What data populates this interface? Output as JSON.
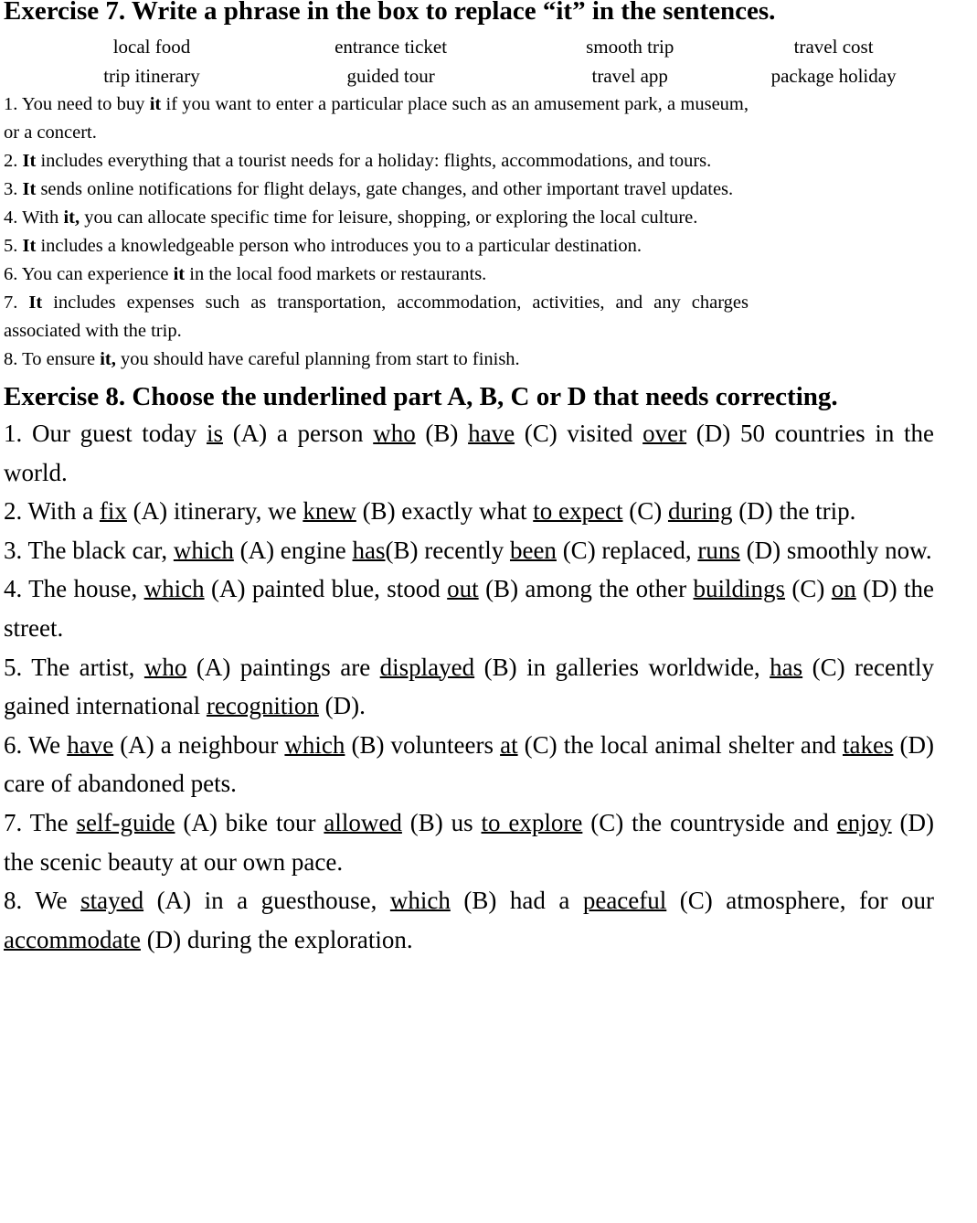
{
  "exercise7": {
    "heading": "Exercise 7. Write a phrase in the box to replace “it” in the sentences.",
    "wordbank": {
      "row1": [
        "local food",
        "entrance ticket",
        "smooth trip",
        "travel cost"
      ],
      "row2": [
        "trip itinerary",
        "guided tour",
        "travel app",
        "package holiday"
      ]
    },
    "items": [
      {
        "number": "1.",
        "parts": [
          {
            "text": " You need to buy ",
            "style": "normal"
          },
          {
            "text": "it",
            "style": "bold"
          },
          {
            "text": " if you want to enter a particular place such as an amusement park, a museum, or a concert.",
            "style": "normal"
          }
        ]
      },
      {
        "number": "2.",
        "parts": [
          {
            "text": " ",
            "style": "normal"
          },
          {
            "text": "It",
            "style": "bold"
          },
          {
            "text": " includes everything that a tourist needs for a holiday: flights, accommodations, and tours.",
            "style": "normal"
          }
        ]
      },
      {
        "number": "3.",
        "parts": [
          {
            "text": " ",
            "style": "normal"
          },
          {
            "text": "It",
            "style": "bold"
          },
          {
            "text": " sends online notifications for flight delays, gate changes, and other important travel updates.",
            "style": "normal"
          }
        ]
      },
      {
        "number": "4.",
        "parts": [
          {
            "text": " With ",
            "style": "normal"
          },
          {
            "text": "it,",
            "style": "bold"
          },
          {
            "text": " you can allocate specific time for leisure, shopping, or exploring the local culture.",
            "style": "normal"
          }
        ]
      },
      {
        "number": "5.",
        "parts": [
          {
            "text": " ",
            "style": "normal"
          },
          {
            "text": "It",
            "style": "bold"
          },
          {
            "text": " includes a knowledgeable person who introduces you to a particular destination.",
            "style": "normal"
          }
        ]
      },
      {
        "number": "6.",
        "parts": [
          {
            "text": " You can experience ",
            "style": "normal"
          },
          {
            "text": "it",
            "style": "bold"
          },
          {
            "text": " in the local food markets or restaurants.",
            "style": "normal"
          }
        ]
      },
      {
        "number": "7.",
        "parts": [
          {
            "text": " ",
            "style": "normal"
          },
          {
            "text": "It",
            "style": "bold"
          },
          {
            "text": " includes expenses such as transportation, accommodation, activities, and any charges associated with the trip.",
            "style": "normal"
          }
        ]
      },
      {
        "number": "8.",
        "parts": [
          {
            "text": " To ensure ",
            "style": "normal"
          },
          {
            "text": "it,",
            "style": "bold"
          },
          {
            "text": " you should have careful planning from start to finish.",
            "style": "normal"
          }
        ]
      }
    ]
  },
  "exercise8": {
    "heading": "Exercise 8. Choose the underlined part A, B, C or D that needs correcting.",
    "items": [
      {
        "number": "1.",
        "parts": [
          {
            "text": " Our guest today ",
            "style": "normal"
          },
          {
            "text": "is",
            "style": "underline"
          },
          {
            "text": " (A) a person ",
            "style": "normal"
          },
          {
            "text": "who",
            "style": "underline"
          },
          {
            "text": " (B) ",
            "style": "normal"
          },
          {
            "text": "have",
            "style": "underline"
          },
          {
            "text": " (C) visited ",
            "style": "normal"
          },
          {
            "text": "over",
            "style": "underline"
          },
          {
            "text": " (D) 50 countries in the world.",
            "style": "normal"
          }
        ]
      },
      {
        "number": "2.",
        "parts": [
          {
            "text": " With a ",
            "style": "normal"
          },
          {
            "text": "fix",
            "style": "underline"
          },
          {
            "text": " (A) itinerary, we ",
            "style": "normal"
          },
          {
            "text": "knew",
            "style": "underline"
          },
          {
            "text": " (B) exactly what ",
            "style": "normal"
          },
          {
            "text": "to expect",
            "style": "underline"
          },
          {
            "text": " (C) ",
            "style": "normal"
          },
          {
            "text": "during",
            "style": "underline"
          },
          {
            "text": " (D) the trip.",
            "style": "normal"
          }
        ]
      },
      {
        "number": "3.",
        "parts": [
          {
            "text": " The black car, ",
            "style": "normal"
          },
          {
            "text": "which",
            "style": "underline"
          },
          {
            "text": " (A) engine ",
            "style": "normal"
          },
          {
            "text": "has",
            "style": "underline"
          },
          {
            "text": "(B) recently ",
            "style": "normal"
          },
          {
            "text": "been",
            "style": "underline"
          },
          {
            "text": " (C) replaced, ",
            "style": "normal"
          },
          {
            "text": "runs",
            "style": "underline"
          },
          {
            "text": " (D) smoothly now.",
            "style": "normal"
          }
        ]
      },
      {
        "number": "4.",
        "parts": [
          {
            "text": " The house, ",
            "style": "normal"
          },
          {
            "text": "which",
            "style": "underline"
          },
          {
            "text": " (A) painted blue, stood ",
            "style": "normal"
          },
          {
            "text": "out",
            "style": "underline"
          },
          {
            "text": " (B) among the other ",
            "style": "normal"
          },
          {
            "text": "buildings",
            "style": "underline"
          },
          {
            "text": " (C) ",
            "style": "normal"
          },
          {
            "text": "on",
            "style": "underline"
          },
          {
            "text": " (D) the street.",
            "style": "normal"
          }
        ]
      },
      {
        "number": "5.",
        "parts": [
          {
            "text": " The artist, ",
            "style": "normal"
          },
          {
            "text": "who",
            "style": "underline"
          },
          {
            "text": " (A) paintings are ",
            "style": "normal"
          },
          {
            "text": "displayed",
            "style": "underline"
          },
          {
            "text": " (B) in galleries worldwide, ",
            "style": "normal"
          },
          {
            "text": "has",
            "style": "underline"
          },
          {
            "text": " (C) recently gained international ",
            "style": "normal"
          },
          {
            "text": "recognition",
            "style": "underline"
          },
          {
            "text": " (D).",
            "style": "normal"
          }
        ]
      },
      {
        "number": "6.",
        "parts": [
          {
            "text": " We ",
            "style": "normal"
          },
          {
            "text": "have",
            "style": "underline"
          },
          {
            "text": " (A) a neighbour ",
            "style": "normal"
          },
          {
            "text": "which",
            "style": "underline"
          },
          {
            "text": " (B) volunteers ",
            "style": "normal"
          },
          {
            "text": "at",
            "style": "underline"
          },
          {
            "text": " (C) the local animal shelter and ",
            "style": "normal"
          },
          {
            "text": "takes",
            "style": "underline"
          },
          {
            "text": " (D) care of abandoned pets.",
            "style": "normal"
          }
        ]
      },
      {
        "number": "7.",
        "parts": [
          {
            "text": " The ",
            "style": "normal"
          },
          {
            "text": "self-guide",
            "style": "underline"
          },
          {
            "text": " (A) bike tour ",
            "style": "normal"
          },
          {
            "text": "allowed",
            "style": "underline"
          },
          {
            "text": " (B) us ",
            "style": "normal"
          },
          {
            "text": "to explore",
            "style": "underline"
          },
          {
            "text": " (C) the countryside and ",
            "style": "normal"
          },
          {
            "text": "enjoy",
            "style": "underline"
          },
          {
            "text": " (D) the scenic beauty at our own pace.",
            "style": "normal"
          }
        ]
      },
      {
        "number": "8.",
        "parts": [
          {
            "text": " We ",
            "style": "normal"
          },
          {
            "text": "stayed",
            "style": "underline"
          },
          {
            "text": " (A) in a guesthouse, ",
            "style": "normal"
          },
          {
            "text": "which",
            "style": "underline"
          },
          {
            "text": " (B) had a ",
            "style": "normal"
          },
          {
            "text": "peaceful",
            "style": "underline"
          },
          {
            "text": " (C) atmosphere, for our ",
            "style": "normal"
          },
          {
            "text": "accommodate",
            "style": "underline"
          },
          {
            "text": " (D) during the exploration.",
            "style": "normal"
          }
        ]
      }
    ]
  }
}
